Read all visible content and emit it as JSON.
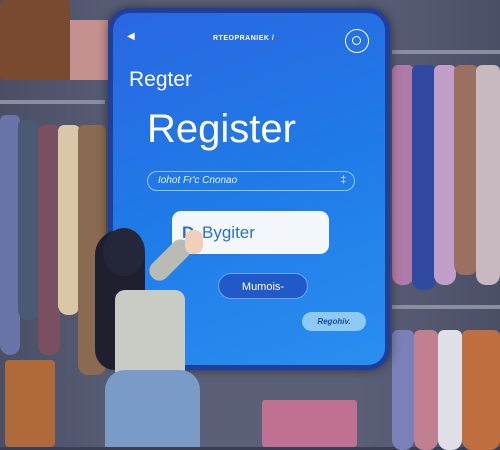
{
  "screen": {
    "header_text": "RTEOPRANIEK /",
    "small_title": "Regter",
    "title": "Register",
    "input_value": "Iohot Fr'c Cnonao",
    "primary_button": "Bygiter",
    "secondary_button": "Mumois-",
    "link_button": "Regohiv.",
    "accent": "#1f7be8"
  }
}
